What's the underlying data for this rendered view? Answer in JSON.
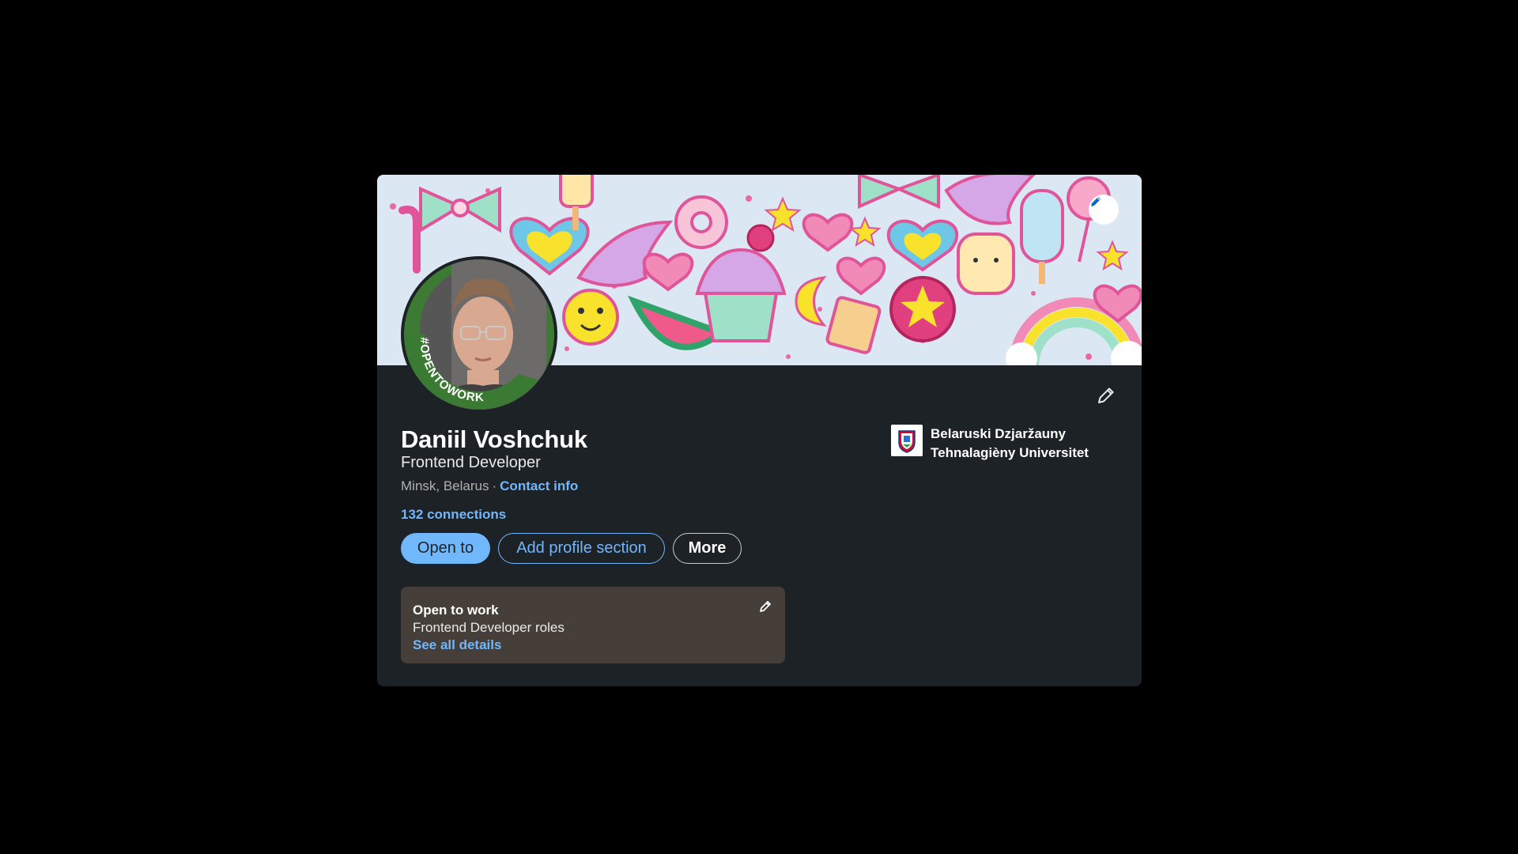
{
  "banner": {
    "edit_icon": "pencil-icon"
  },
  "avatar": {
    "frame_text": "#OPENTOWORK",
    "frame_color": "#3a7a33"
  },
  "profile": {
    "name": "Daniil Voshchuk",
    "headline": "Frontend Developer",
    "location": "Minsk, Belarus",
    "separator": "·",
    "contact_info_label": "Contact info",
    "connections_label": "132 connections",
    "edit_icon": "pencil-icon"
  },
  "actions": {
    "open_to_label": "Open to",
    "add_section_label": "Add profile section",
    "more_label": "More"
  },
  "open_to_work": {
    "title": "Open to work",
    "roles": "Frontend Developer roles",
    "details_link": "See all details",
    "edit_icon": "pencil-icon"
  },
  "education": {
    "line1": "Belaruski Dzjaržauny",
    "line2": "Tehnalagièny Universitet",
    "logo_icon": "university-crest-icon"
  },
  "colors": {
    "page_bg": "#000000",
    "card_bg": "#1d2226",
    "accent": "#71b7fb",
    "otw_box_bg": "#463f39"
  }
}
